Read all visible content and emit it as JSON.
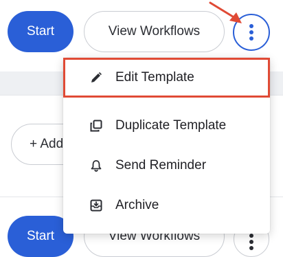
{
  "row1": {
    "start_label": "Start",
    "view_workflows_label": "View Workflows"
  },
  "row2": {
    "add_label": "+ Add"
  },
  "row3": {
    "start_label": "Start",
    "view_workflows_label": "View Workflows"
  },
  "menu": {
    "items": [
      {
        "label": "Edit Template",
        "icon": "pencil-icon"
      },
      {
        "label": "Duplicate Template",
        "icon": "duplicate-icon"
      },
      {
        "label": "Send Reminder",
        "icon": "bell-icon"
      },
      {
        "label": "Archive",
        "icon": "archive-icon"
      }
    ]
  },
  "colors": {
    "primary": "#2a5fd7",
    "highlight": "#e04a35",
    "band": "#eef0f3"
  }
}
